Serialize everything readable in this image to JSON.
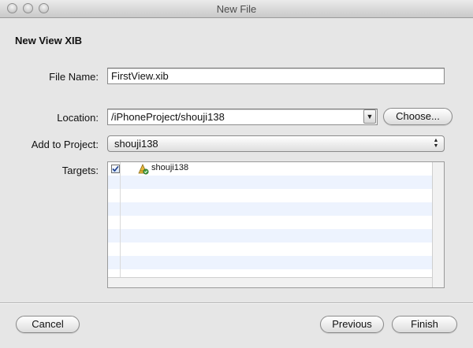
{
  "window": {
    "title": "New File"
  },
  "heading": "New View XIB",
  "file_name": {
    "label": "File Name:",
    "value": "FirstView.xib"
  },
  "location": {
    "label": "Location:",
    "value": "/iPhoneProject/shouji138",
    "choose_label": "Choose...",
    "arrow_icon": "triangle-down-icon"
  },
  "add_to_project": {
    "label": "Add to Project:",
    "value": "shouji138",
    "arrow_icon": "up-down-arrows-icon"
  },
  "targets": {
    "label": "Targets:",
    "items": [
      {
        "name": "shouji138",
        "checked": true,
        "icon": "app-target-icon"
      }
    ]
  },
  "buttons": {
    "cancel": "Cancel",
    "previous": "Previous",
    "finish": "Finish"
  }
}
